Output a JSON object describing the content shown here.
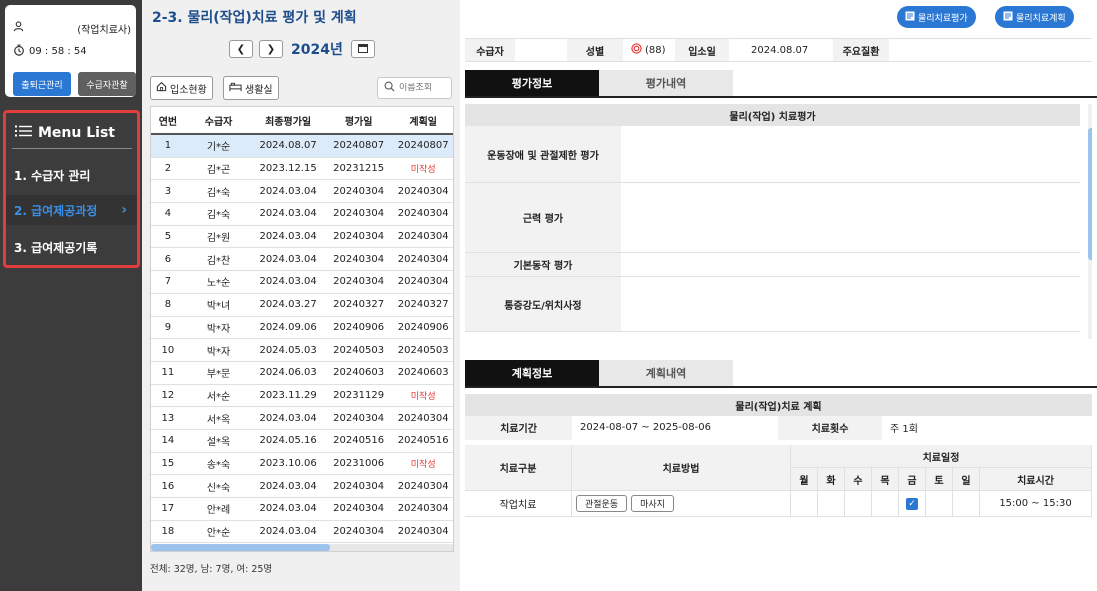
{
  "user": {
    "role": "(작업치료사)",
    "time": "09 : 58 : 54",
    "attendance_button": "출퇴근관리",
    "observation_button": "수급자관찰"
  },
  "menu": {
    "title": "Menu List",
    "items": [
      {
        "label": "1. 수급자 관리",
        "active": false
      },
      {
        "label": "2. 급여제공과정",
        "active": true
      },
      {
        "label": "3. 급여제공기록",
        "active": false
      }
    ]
  },
  "list_panel": {
    "page_title": "2-3. 물리(작업)치료 평가 및 계획",
    "year": "2024년",
    "tab_admission": "입소현황",
    "tab_living_room": "생활실",
    "search_placeholder": "이름조회",
    "columns": [
      "연번",
      "수급자",
      "최종평가일",
      "평가일",
      "계획일"
    ],
    "rows": [
      {
        "no": "1",
        "name": "기*순",
        "last_eval": "2024.08.07",
        "eval": "20240807",
        "plan": "20240807",
        "plan_missing": false,
        "selected": true
      },
      {
        "no": "2",
        "name": "김*곤",
        "last_eval": "2023.12.15",
        "eval": "20231215",
        "plan": "미작성",
        "plan_missing": true,
        "selected": false
      },
      {
        "no": "3",
        "name": "김*숙",
        "last_eval": "2024.03.04",
        "eval": "20240304",
        "plan": "20240304",
        "plan_missing": false,
        "selected": false
      },
      {
        "no": "4",
        "name": "김*숙",
        "last_eval": "2024.03.04",
        "eval": "20240304",
        "plan": "20240304",
        "plan_missing": false,
        "selected": false
      },
      {
        "no": "5",
        "name": "김*원",
        "last_eval": "2024.03.04",
        "eval": "20240304",
        "plan": "20240304",
        "plan_missing": false,
        "selected": false
      },
      {
        "no": "6",
        "name": "김*찬",
        "last_eval": "2024.03.04",
        "eval": "20240304",
        "plan": "20240304",
        "plan_missing": false,
        "selected": false
      },
      {
        "no": "7",
        "name": "노*순",
        "last_eval": "2024.03.04",
        "eval": "20240304",
        "plan": "20240304",
        "plan_missing": false,
        "selected": false
      },
      {
        "no": "8",
        "name": "박*녀",
        "last_eval": "2024.03.27",
        "eval": "20240327",
        "plan": "20240327",
        "plan_missing": false,
        "selected": false
      },
      {
        "no": "9",
        "name": "박*자",
        "last_eval": "2024.09.06",
        "eval": "20240906",
        "plan": "20240906",
        "plan_missing": false,
        "selected": false
      },
      {
        "no": "10",
        "name": "박*자",
        "last_eval": "2024.05.03",
        "eval": "20240503",
        "plan": "20240503",
        "plan_missing": false,
        "selected": false
      },
      {
        "no": "11",
        "name": "부*문",
        "last_eval": "2024.06.03",
        "eval": "20240603",
        "plan": "20240603",
        "plan_missing": false,
        "selected": false
      },
      {
        "no": "12",
        "name": "서*순",
        "last_eval": "2023.11.29",
        "eval": "20231129",
        "plan": "미작성",
        "plan_missing": true,
        "selected": false
      },
      {
        "no": "13",
        "name": "서*옥",
        "last_eval": "2024.03.04",
        "eval": "20240304",
        "plan": "20240304",
        "plan_missing": false,
        "selected": false
      },
      {
        "no": "14",
        "name": "설*옥",
        "last_eval": "2024.05.16",
        "eval": "20240516",
        "plan": "20240516",
        "plan_missing": false,
        "selected": false
      },
      {
        "no": "15",
        "name": "송*숙",
        "last_eval": "2023.10.06",
        "eval": "20231006",
        "plan": "미작성",
        "plan_missing": true,
        "selected": false
      },
      {
        "no": "16",
        "name": "신*숙",
        "last_eval": "2024.03.04",
        "eval": "20240304",
        "plan": "20240304",
        "plan_missing": false,
        "selected": false
      },
      {
        "no": "17",
        "name": "안*례",
        "last_eval": "2024.03.04",
        "eval": "20240304",
        "plan": "20240304",
        "plan_missing": false,
        "selected": false
      },
      {
        "no": "18",
        "name": "안*순",
        "last_eval": "2024.03.04",
        "eval": "20240304",
        "plan": "20240304",
        "plan_missing": false,
        "selected": false
      }
    ],
    "summary": "전체: 32명, 남: 7명, 여: 25명",
    "horizontal_scroll_fraction": 0.59
  },
  "detail": {
    "btn_eval": "물리치료평가",
    "btn_plan": "물리치료계획",
    "info": {
      "recipient_label": "수급자",
      "recipient_value": "",
      "gender_label": "성별",
      "gender_value": "(88)",
      "admission_label": "입소일",
      "admission_value": "2024.08.07",
      "disease_label": "주요질환",
      "disease_value": ""
    },
    "eval_tab_active": "평가정보",
    "eval_tab_history": "평가내역",
    "eval_table_title": "물리(작업) 치료평가",
    "eval_rows": [
      "운동장애 및 관절제한 평가",
      "근력 평가",
      "기본동작 평가",
      "통증강도/위치사정"
    ],
    "plan_tab_active": "계획정보",
    "plan_tab_history": "계획내역",
    "plan_table_title": "물리(작업)치료 계획",
    "period_label": "치료기간",
    "period_value": "2024-08-07 ~ 2025-08-06",
    "count_label": "치료횟수",
    "count_value": "주 1회",
    "col_type": "치료구분",
    "col_method": "치료방법",
    "col_schedule": "치료일정",
    "days": [
      "월",
      "화",
      "수",
      "목",
      "금",
      "토",
      "일"
    ],
    "col_time": "치료시간",
    "plan_row": {
      "type": "작업치료",
      "methods": [
        "관절운동",
        "마사지"
      ],
      "checked_days": [
        "금"
      ],
      "time": "15:00 ~ 15:30"
    }
  },
  "colors": {
    "accent": "#2b78d4",
    "title": "#1d4d8c",
    "sidebar": "#3c3c3c",
    "highlight_border": "#e23d3d",
    "missing_text": "#e53935",
    "selected_row": "#dcebfa"
  }
}
